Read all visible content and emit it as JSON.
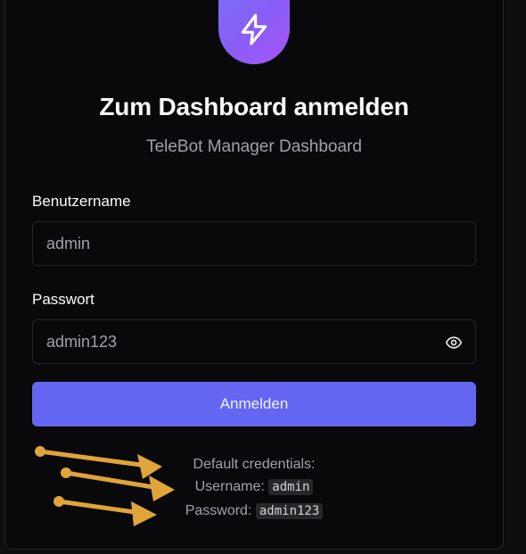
{
  "header": {
    "logo_icon": "bolt-icon",
    "title": "Zum Dashboard anmelden",
    "subtitle": "TeleBot Manager Dashboard"
  },
  "form": {
    "username_label": "Benutzername",
    "username_value": "admin",
    "password_label": "Passwort",
    "password_value": "admin123",
    "toggle_icon": "eye-icon",
    "submit_label": "Anmelden"
  },
  "credentials": {
    "heading": "Default credentials:",
    "username_label": "Username:",
    "username_value": "admin",
    "password_label": "Password:",
    "password_value": "admin123"
  },
  "colors": {
    "accent": "#6366f1",
    "annotation_arrow": "#e0a43a",
    "logo_gradient_start": "#7c6cf4",
    "logo_gradient_end": "#a855f7"
  }
}
